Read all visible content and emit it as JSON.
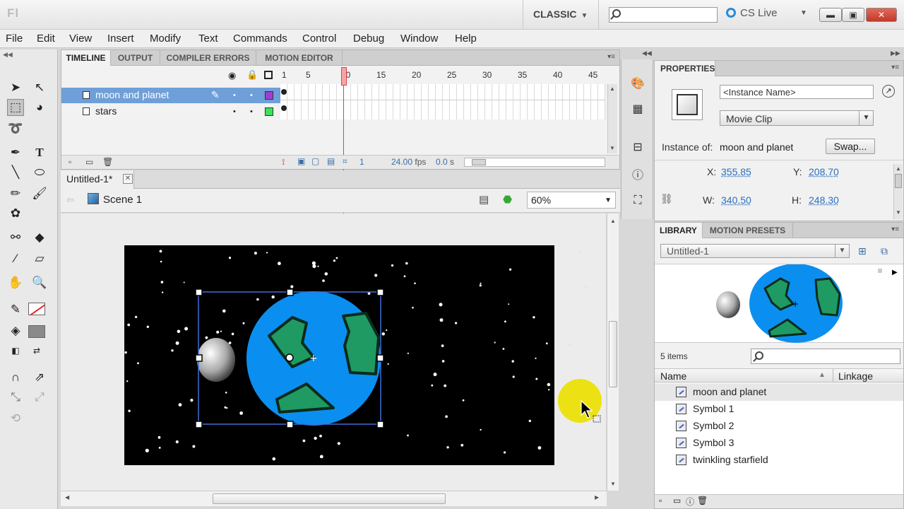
{
  "window": {
    "app_logo": "Fl",
    "workspace": "CLASSIC",
    "search_placeholder": "",
    "cs_live": "CS Live"
  },
  "menu": [
    "File",
    "Edit",
    "View",
    "Insert",
    "Modify",
    "Text",
    "Commands",
    "Control",
    "Debug",
    "Window",
    "Help"
  ],
  "timeline": {
    "tabs": [
      "TIMELINE",
      "OUTPUT",
      "COMPILER ERRORS",
      "MOTION EDITOR"
    ],
    "frame_numbers": [
      "1",
      "5",
      "10",
      "15",
      "20",
      "25",
      "30",
      "35",
      "40",
      "45"
    ],
    "layers": [
      {
        "name": "moon and planet",
        "selected": true,
        "color": "#9b3fd6"
      },
      {
        "name": "stars",
        "selected": false,
        "color": "#3fe05c"
      }
    ],
    "current_frame": "1",
    "fps": "24.00",
    "fps_unit": "fps",
    "time": "0.0",
    "time_unit": "s"
  },
  "document": {
    "tab_title": "Untitled-1*",
    "scene": "Scene 1",
    "zoom": "60%"
  },
  "properties": {
    "tab": "PROPERTIES",
    "instance_name_placeholder": "<Instance Name>",
    "symbol_type": "Movie Clip",
    "instance_of_label": "Instance of:",
    "instance_of_value": "moon and planet",
    "swap_label": "Swap...",
    "x_label": "X:",
    "x_value": "355.85",
    "y_label": "Y:",
    "y_value": "208.70",
    "w_label": "W:",
    "w_value": "340.50",
    "h_label": "H:",
    "h_value": "248.30"
  },
  "library": {
    "tabs": [
      "LIBRARY",
      "MOTION PRESETS"
    ],
    "document": "Untitled-1",
    "count": "5 items",
    "col_name": "Name",
    "col_linkage": "Linkage",
    "items": [
      "moon and planet",
      "Symbol 1",
      "Symbol 2",
      "Symbol 3",
      "twinkling starfield"
    ]
  },
  "colors": {
    "planet": "#0a8ff0",
    "land": "#1f9a62",
    "selection": "#3f6fd8",
    "cursor_highlight": "#ebe100"
  }
}
